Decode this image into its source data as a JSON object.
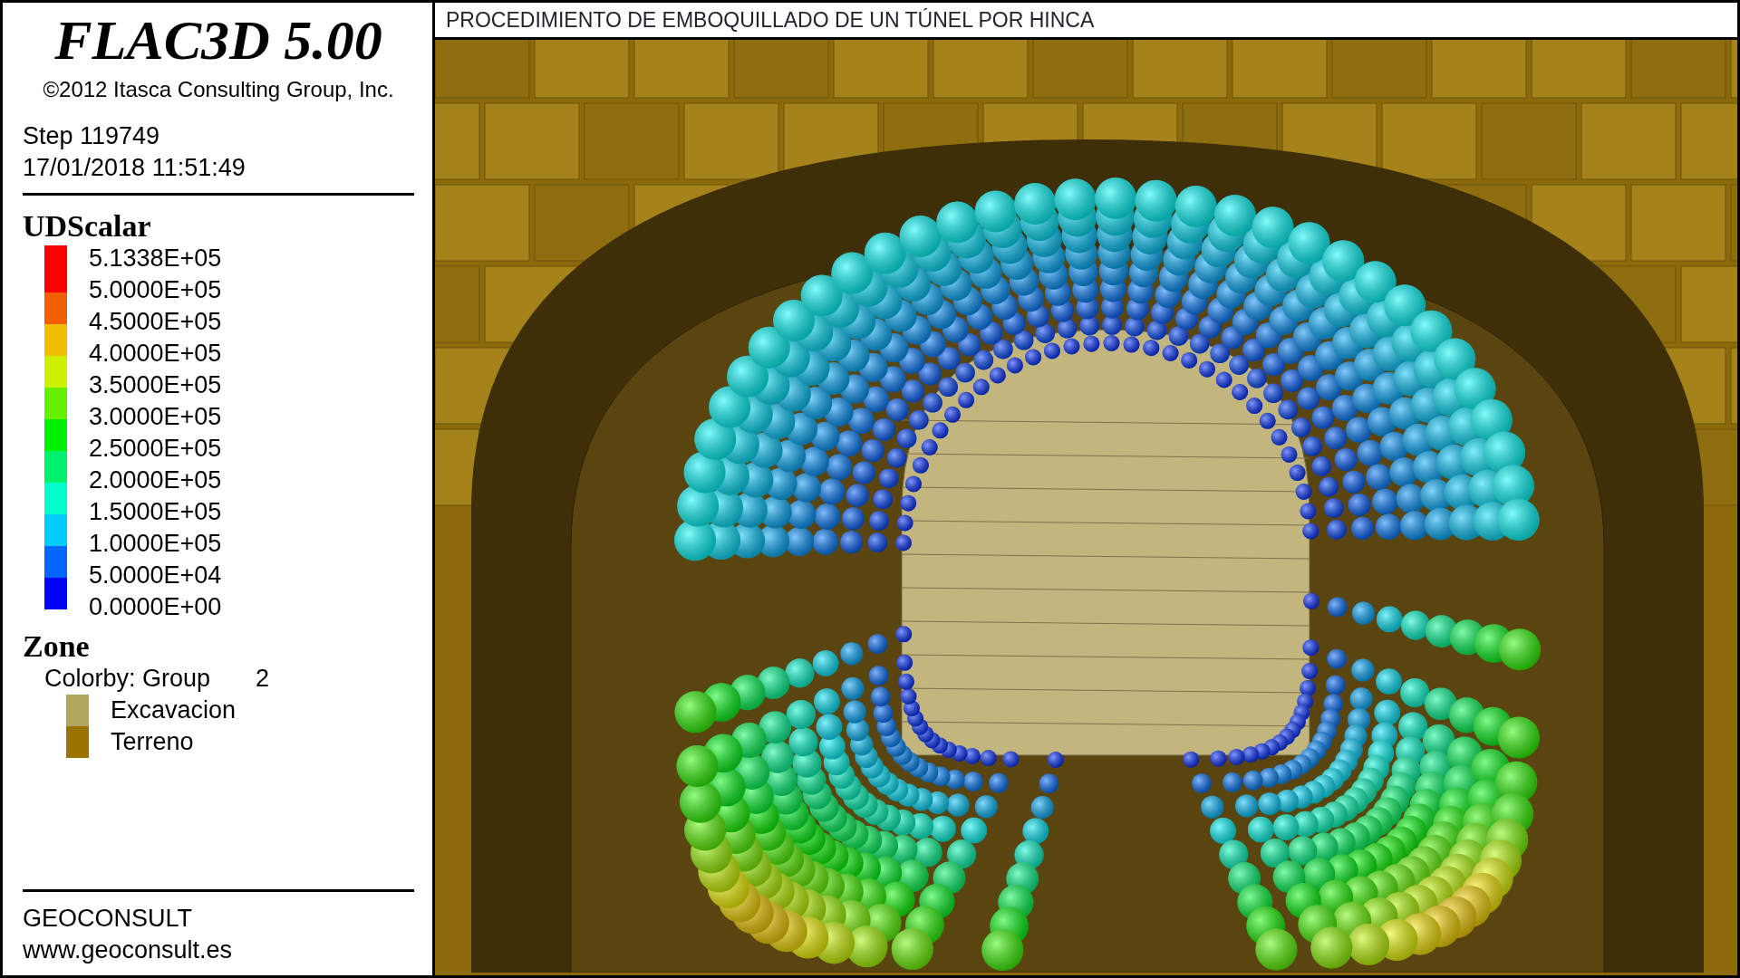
{
  "legend": {
    "product": "FLAC3D 5.00",
    "copyright": "©2012 Itasca Consulting Group, Inc.",
    "step": "Step 119749",
    "timestamp": "17/01/2018 11:51:49",
    "scalar": {
      "title": "UDScalar",
      "labels": [
        "5.1338E+05",
        "5.0000E+05",
        "4.5000E+05",
        "4.0000E+05",
        "3.5000E+05",
        "3.0000E+05",
        "2.5000E+05",
        "2.0000E+05",
        "1.5000E+05",
        "1.0000E+05",
        "5.0000E+04",
        "0.0000E+00"
      ],
      "bands": [
        {
          "color": "#ff0000"
        },
        {
          "color": "#f06000"
        },
        {
          "color": "#f0c000"
        },
        {
          "color": "#ccf000"
        },
        {
          "color": "#66f000"
        },
        {
          "color": "#00f000"
        },
        {
          "color": "#00f070"
        },
        {
          "color": "#00ffcc"
        },
        {
          "color": "#00ccff"
        },
        {
          "color": "#0066ff"
        },
        {
          "color": "#0000ff"
        }
      ]
    },
    "zone": {
      "title": "Zone",
      "colorby": "Colorby: Group",
      "colorby_value": "2",
      "groups": [
        {
          "label": "Excavacion",
          "color": "#b0a860"
        },
        {
          "label": "Terreno",
          "color": "#9a7400"
        }
      ]
    },
    "footer": {
      "company": "GEOCONSULT",
      "url": "www.geoconsult.es"
    }
  },
  "view": {
    "title": "PROCEDIMIENTO DE EMBOQUILLADO DE UN TÚNEL POR HINCA"
  }
}
